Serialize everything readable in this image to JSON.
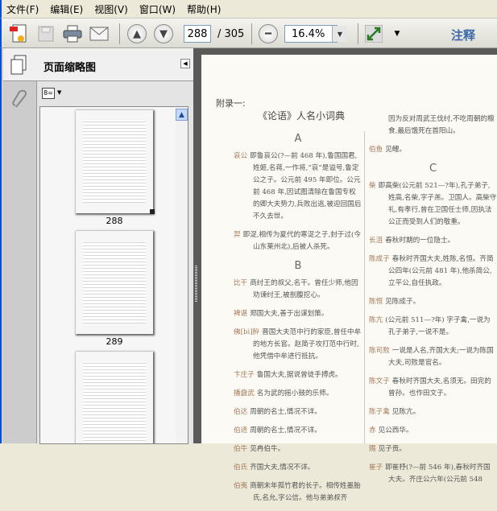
{
  "menu": [
    "文件(F)",
    "编辑(E)",
    "视图(V)",
    "窗口(W)",
    "帮助(H)"
  ],
  "toolbar": {
    "current_page": "288",
    "total_pages": "/ 305",
    "zoom": "16.4%",
    "comment_label": "注释"
  },
  "panel": {
    "title": "页面缩略图",
    "thumbnails": [
      "288",
      "289"
    ]
  },
  "document": {
    "appendix": "附录一:",
    "title": "《论语》人名小词典",
    "left_column": [
      {
        "type": "letter",
        "text": "A"
      },
      {
        "type": "entry",
        "name": "哀公",
        "text": "即鲁哀公(?—前 468 年),鲁国国君,姓姬,名蒋,一作将,“哀”是谥号,鲁定公之子。公元前 495 年即位。公元前 468 年,因试图清除在鲁国专权的卿大夫势力,兵败出逃,被迎回国后不久去世。"
      },
      {
        "type": "entry",
        "name": "羿",
        "text": "即浞,相传为夏代的寒浞之子,封于过(今山东莱州北),后被人杀死。"
      },
      {
        "type": "letter",
        "text": "B"
      },
      {
        "type": "entry",
        "name": "比干",
        "text": "商纣王的叔父,名干。曾任少师,他因劝谏纣王,被剖腹挖心。"
      },
      {
        "type": "entry",
        "name": "裨谌",
        "text": "郑国大夫,善于出谋划策。"
      },
      {
        "type": "entry",
        "name": "佛[bì]肸",
        "text": "晋国大夫范中行的家臣,曾任中牟的地方长官。赵简子攻打范中行时,他凭借中牟进行抵抗。"
      },
      {
        "type": "entry",
        "name": "卞庄子",
        "text": "鲁国大夫,据说曾徒手搏虎。"
      },
      {
        "type": "entry",
        "name": "播鼗武",
        "text": "名为武的摇小鼓的乐师。"
      },
      {
        "type": "entry",
        "name": "伯达",
        "text": "周朝的名士,情况不详。"
      },
      {
        "type": "entry",
        "name": "伯适",
        "text": "周朝的名士,情况不详。"
      },
      {
        "type": "entry",
        "name": "伯牛",
        "text": "见冉伯牛。"
      },
      {
        "type": "entry",
        "name": "伯氏",
        "text": "齐国大夫,情况不详。"
      },
      {
        "type": "entry",
        "name": "伯夷",
        "text": "商朝末年孤竹君的长子。相传姓墨胎氏,名允,字公信。他与弟弟叔齐"
      }
    ],
    "right_column": [
      {
        "type": "entry",
        "name": "",
        "text": "因为反对周武王伐纣,不吃周朝的粮食,最后饿死在首阳山。"
      },
      {
        "type": "entry",
        "name": "伯鱼",
        "text": "见鲤。"
      },
      {
        "type": "letter",
        "text": "C"
      },
      {
        "type": "entry",
        "name": "柴",
        "text": "即高柴(公元前 521—?年),孔子弟子,姓高,名柴,字子羔。卫国人。高柴守礼,有孝行,曾在卫国任士师,因执法公正而受到人们的敬重。"
      },
      {
        "type": "entry",
        "name": "长沮",
        "text": "春秋时期的一位隐士。"
      },
      {
        "type": "entry",
        "name": "陈成子",
        "text": "春秋时齐国大夫,姓陈,名恒。齐简公四年(公元前 481 年),他杀简公,立平公,自任执政。"
      },
      {
        "type": "entry",
        "name": "陈恒",
        "text": "见陈成子。"
      },
      {
        "type": "entry",
        "name": "陈亢",
        "text": "(公元前 511—?年) 字子禽,一说为孔子弟子,一说不是。"
      },
      {
        "type": "entry",
        "name": "陈司败",
        "text": "一说是人名,齐国大夫;一说为陈国大夫,司败是官名。"
      },
      {
        "type": "entry",
        "name": "陈文子",
        "text": "春秋时齐国大夫,名须无。田完的曾孙。也作田文子。"
      },
      {
        "type": "entry",
        "name": "陈子禽",
        "text": "见陈亢。"
      },
      {
        "type": "entry",
        "name": "赤",
        "text": "见公西华。"
      },
      {
        "type": "entry",
        "name": "赐",
        "text": "见子贡。"
      },
      {
        "type": "entry",
        "name": "崔子",
        "text": "即崔杼(?—前 546 年),春秋时齐国大夫。齐庄公六年(公元前 548"
      }
    ]
  }
}
